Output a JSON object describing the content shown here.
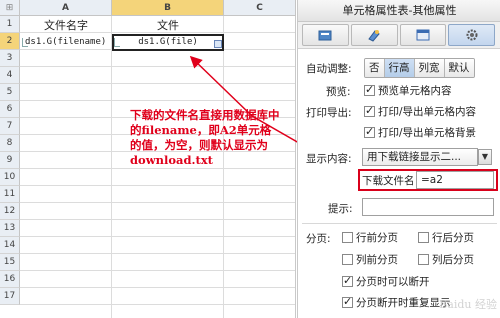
{
  "sheet": {
    "corner": "⊞",
    "columns": [
      "A",
      "B",
      "C"
    ],
    "rows": [
      "1",
      "2",
      "3",
      "4",
      "5",
      "6",
      "7",
      "8",
      "9",
      "10",
      "11",
      "12",
      "13",
      "14",
      "15",
      "16",
      "17"
    ],
    "cells": {
      "A1": "文件名字",
      "B1": "文件",
      "A2": "ds1.G(filename)",
      "B2": "ds1.G(file)"
    },
    "annotation": "下载的文件名直接用数据库中的filename，即A2单元格的值，为空，则默认显示为download.txt"
  },
  "panel": {
    "title": "单元格属性表-其他属性",
    "tabs": [
      {
        "icon": "style-icon"
      },
      {
        "icon": "link-icon"
      },
      {
        "icon": "layout-icon"
      },
      {
        "icon": "gear-icon"
      }
    ],
    "auto_adjust": {
      "label": "自动调整:",
      "options": [
        "否",
        "行高",
        "列宽",
        "默认"
      ],
      "selected": "行高"
    },
    "preview": {
      "label": "预览:",
      "checkbox": "预览单元格内容",
      "checked": true
    },
    "print_export": {
      "label": "打印导出:",
      "options": [
        {
          "text": "打印/导出单元格内容",
          "checked": true
        },
        {
          "text": "打印/导出单元格背景",
          "checked": true
        }
      ]
    },
    "display_content": {
      "label": "显示内容:",
      "value": "用下载链接显示二..."
    },
    "download_filename": {
      "label": "下载文件名",
      "value": "=a2"
    },
    "tooltip": {
      "label": "提示:",
      "value": ""
    },
    "paging": {
      "label": "分页:",
      "options": [
        {
          "text": "行前分页",
          "checked": false
        },
        {
          "text": "行后分页",
          "checked": false
        },
        {
          "text": "列前分页",
          "checked": false
        },
        {
          "text": "列后分页",
          "checked": false
        },
        {
          "text": "分页时可以断开",
          "checked": true
        },
        {
          "text": "分页断开时重复显示",
          "checked": true
        }
      ]
    },
    "watermark": "Baidu 经验"
  },
  "colors": {
    "annotation_red": "#e0001b",
    "selection": "#f4d47a"
  }
}
